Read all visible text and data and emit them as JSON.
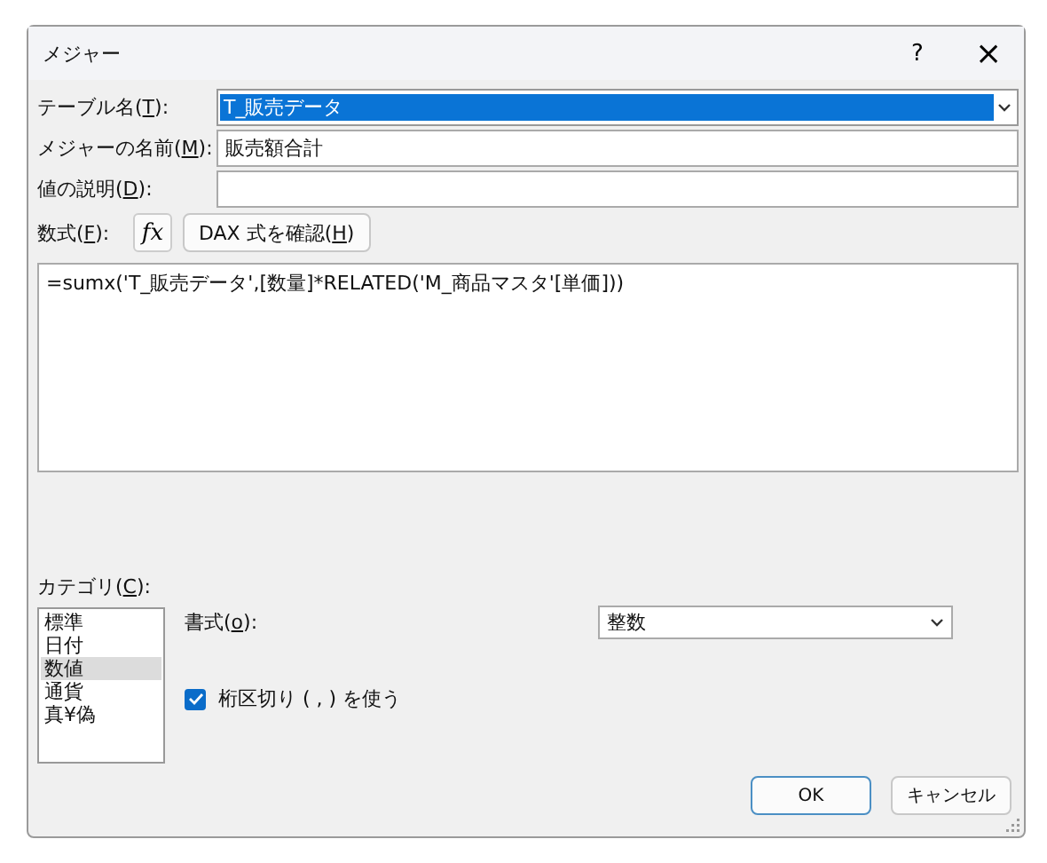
{
  "window": {
    "title": "メジャー",
    "help": "?",
    "close": "×"
  },
  "fields": [
    {
      "kind": "combo",
      "label": {
        "before": "テーブル名(",
        "key": "T",
        "after": "):"
      },
      "value": "T_販売データ",
      "selected": true
    },
    {
      "kind": "text",
      "label": {
        "before": "メジャーの名前(",
        "key": "M",
        "after": "):"
      },
      "value": "販売額合計",
      "selected": false
    },
    {
      "kind": "text",
      "label": {
        "before": "値の説明(",
        "key": "D",
        "after": "):"
      },
      "selected": false
    }
  ],
  "formula": {
    "label": {
      "before": "数式(",
      "key": "F",
      "after": "):"
    },
    "fx": "fx",
    "check_button": {
      "before": "DAX 式を確認(",
      "key": "H",
      "after": ")"
    },
    "value": "=sumx('T_販売データ',[数量]*RELATED('M_商品マスタ'[単価]))"
  },
  "category": {
    "label": {
      "before": "カテゴリ(",
      "key": "C",
      "after": "):"
    },
    "items": [
      {
        "label": "標準",
        "selected": false
      },
      {
        "label": "日付",
        "selected": false
      },
      {
        "label": "数値",
        "selected": true
      },
      {
        "label": "通貨",
        "selected": false
      },
      {
        "label": "真¥偽",
        "selected": false
      }
    ]
  },
  "format": {
    "label": {
      "before": "書式(",
      "key": "o",
      "after": "):"
    },
    "value": "整数"
  },
  "thousands_separator": {
    "label": "桁区切り ( , ) を使う",
    "checked": true
  },
  "buttons": [
    {
      "label": "OK",
      "default": true
    },
    {
      "label": "キャンセル",
      "default": false
    }
  ]
}
